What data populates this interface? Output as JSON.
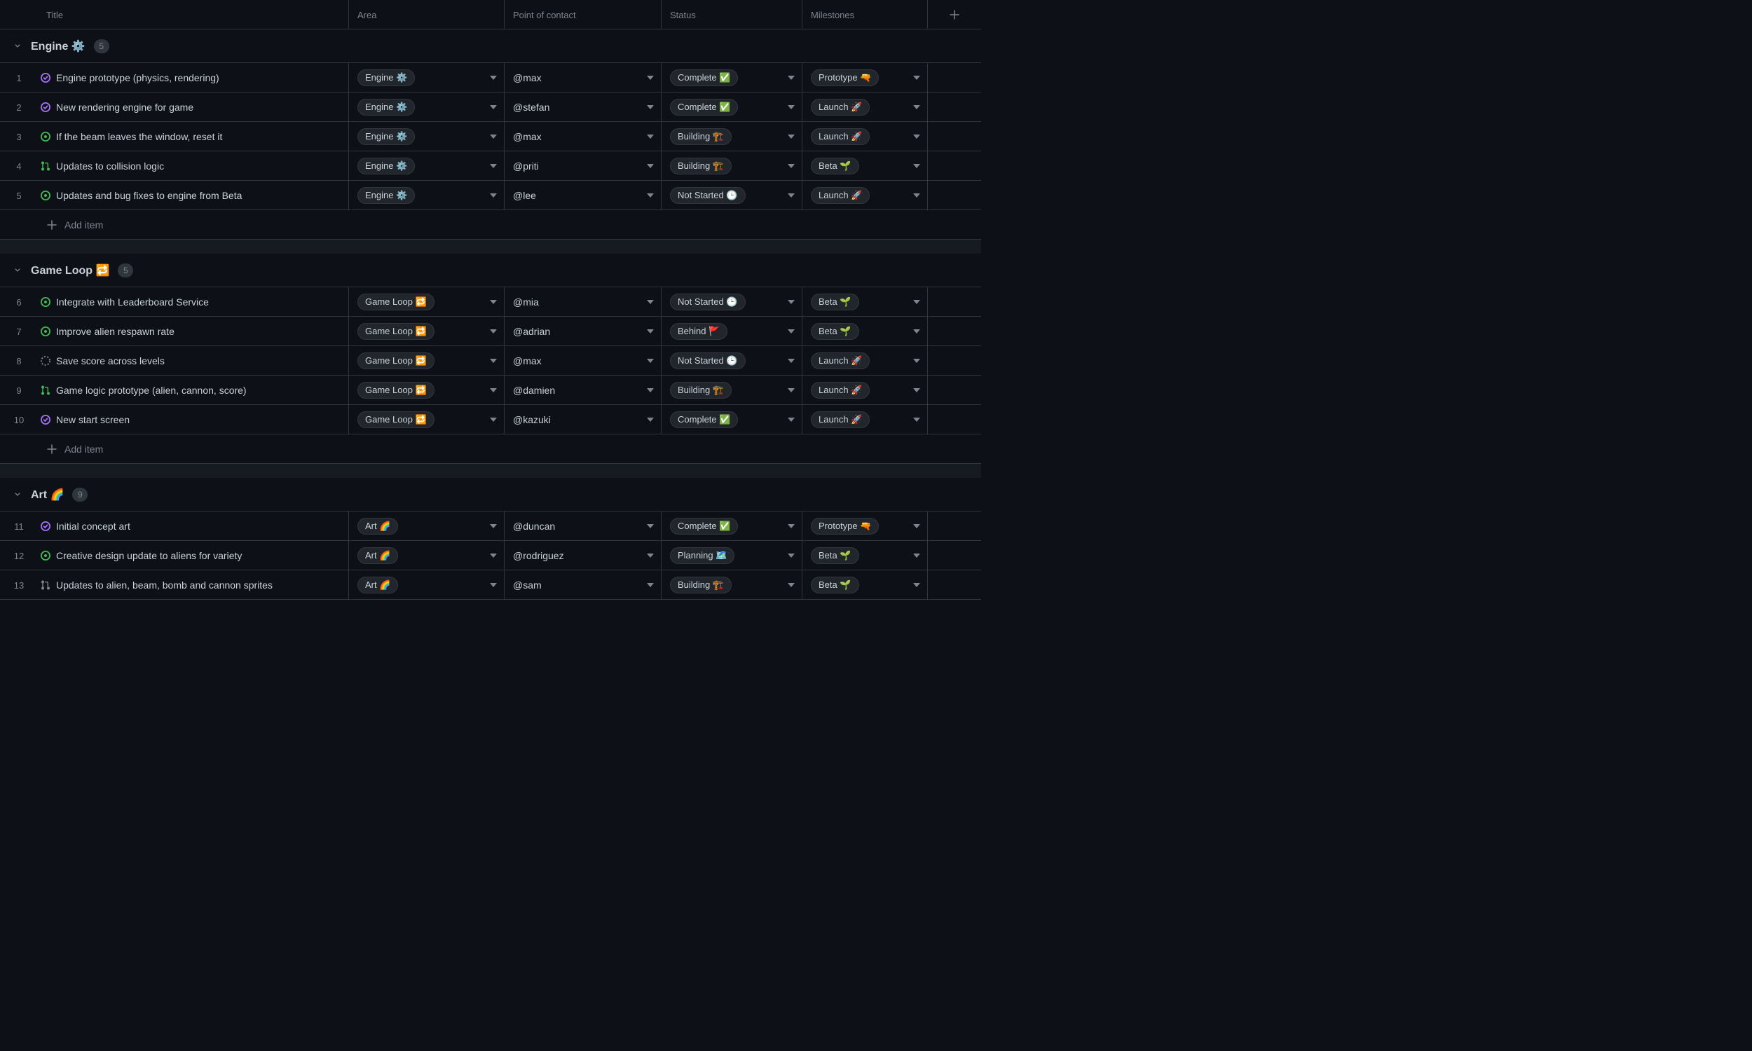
{
  "columns": {
    "title": "Title",
    "area": "Area",
    "contact": "Point of contact",
    "status": "Status",
    "milestones": "Milestones"
  },
  "add_item_label": "Add item",
  "groups": [
    {
      "name": "Engine ⚙️",
      "count": 5,
      "rows": [
        {
          "num": "1",
          "icon": "closed",
          "title": "Engine prototype (physics, rendering)",
          "area": "Engine ⚙️",
          "contact": "@max",
          "status": "Complete ✅",
          "milestone": "Prototype 🔫"
        },
        {
          "num": "2",
          "icon": "closed",
          "title": "New rendering engine for game",
          "area": "Engine ⚙️",
          "contact": "@stefan",
          "status": "Complete ✅",
          "milestone": "Launch 🚀"
        },
        {
          "num": "3",
          "icon": "open",
          "title": "If the beam leaves the window, reset it",
          "area": "Engine ⚙️",
          "contact": "@max",
          "status": "Building 🏗️",
          "milestone": "Launch 🚀"
        },
        {
          "num": "4",
          "icon": "pr",
          "title": "Updates to collision logic",
          "area": "Engine ⚙️",
          "contact": "@priti",
          "status": "Building 🏗️",
          "milestone": "Beta 🌱"
        },
        {
          "num": "5",
          "icon": "open",
          "title": "Updates and bug fixes to engine from Beta",
          "area": "Engine ⚙️",
          "contact": "@lee",
          "status": "Not Started 🕒",
          "milestone": "Launch 🚀"
        }
      ]
    },
    {
      "name": "Game Loop 🔁",
      "count": 5,
      "rows": [
        {
          "num": "6",
          "icon": "open",
          "title": "Integrate with Leaderboard Service",
          "area": "Game Loop 🔁",
          "contact": "@mia",
          "status": "Not Started 🕒",
          "milestone": "Beta 🌱"
        },
        {
          "num": "7",
          "icon": "open",
          "title": "Improve alien respawn rate",
          "area": "Game Loop 🔁",
          "contact": "@adrian",
          "status": "Behind 🚩",
          "milestone": "Beta 🌱"
        },
        {
          "num": "8",
          "icon": "draft",
          "title": "Save score across levels",
          "area": "Game Loop 🔁",
          "contact": "@max",
          "status": "Not Started 🕒",
          "milestone": "Launch 🚀"
        },
        {
          "num": "9",
          "icon": "pr",
          "title": "Game logic prototype (alien, cannon, score)",
          "area": "Game Loop 🔁",
          "contact": "@damien",
          "status": "Building 🏗️",
          "milestone": "Launch 🚀"
        },
        {
          "num": "10",
          "icon": "closed",
          "title": "New start screen",
          "area": "Game Loop 🔁",
          "contact": "@kazuki",
          "status": "Complete ✅",
          "milestone": "Launch 🚀"
        }
      ]
    },
    {
      "name": "Art 🌈",
      "count": 9,
      "rows": [
        {
          "num": "11",
          "icon": "closed",
          "title": "Initial concept art",
          "area": "Art 🌈",
          "contact": "@duncan",
          "status": "Complete ✅",
          "milestone": "Prototype 🔫"
        },
        {
          "num": "12",
          "icon": "open",
          "title": "Creative design update to aliens for variety",
          "area": "Art 🌈",
          "contact": "@rodriguez",
          "status": "Planning 🗺️",
          "milestone": "Beta 🌱"
        },
        {
          "num": "13",
          "icon": "pr-draft",
          "title": "Updates to alien, beam, bomb and cannon sprites",
          "area": "Art 🌈",
          "contact": "@sam",
          "status": "Building 🏗️",
          "milestone": "Beta 🌱"
        }
      ]
    }
  ]
}
